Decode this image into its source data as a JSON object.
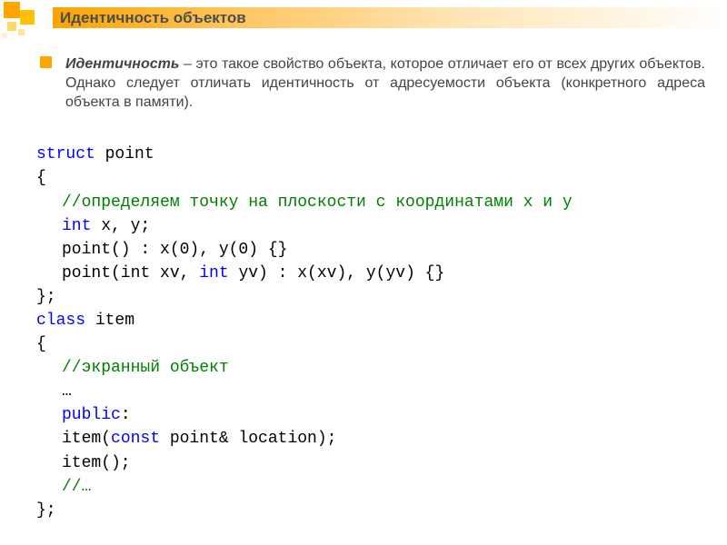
{
  "header": {
    "title": "Идентичность объектов"
  },
  "definition": {
    "term": "Идентичность",
    "text": " – это такое свойство объекта, которое отличает его от всех других объектов. Однако следует отличать идентичность от адресуемости объекта (конкретного адреса объекта в памяти)."
  },
  "code": {
    "l01_kw": "struct",
    "l01_rest": " point",
    "l02": "{",
    "l03_cmt": "//определяем точку на плоскости с координатами x и y",
    "l04_kw": "int",
    "l04_rest": " x, y;",
    "l05": "point() : x(0), y(0) {}",
    "l06_a": "point(int xv, ",
    "l06_kw": "int",
    "l06_b": " yv) : x(xv), y(yv) {}",
    "l07": "};",
    "l08_kw": "class",
    "l08_rest": " item",
    "l09": "{",
    "l10_cmt": "//экранный объект",
    "l11": "…",
    "l12_kw": "public",
    "l12_rest": ":",
    "l13_a": "item(",
    "l13_kw": "const",
    "l13_b": " point& location);",
    "l14": "item();",
    "l15_cmt": "//…",
    "l16": "};"
  }
}
